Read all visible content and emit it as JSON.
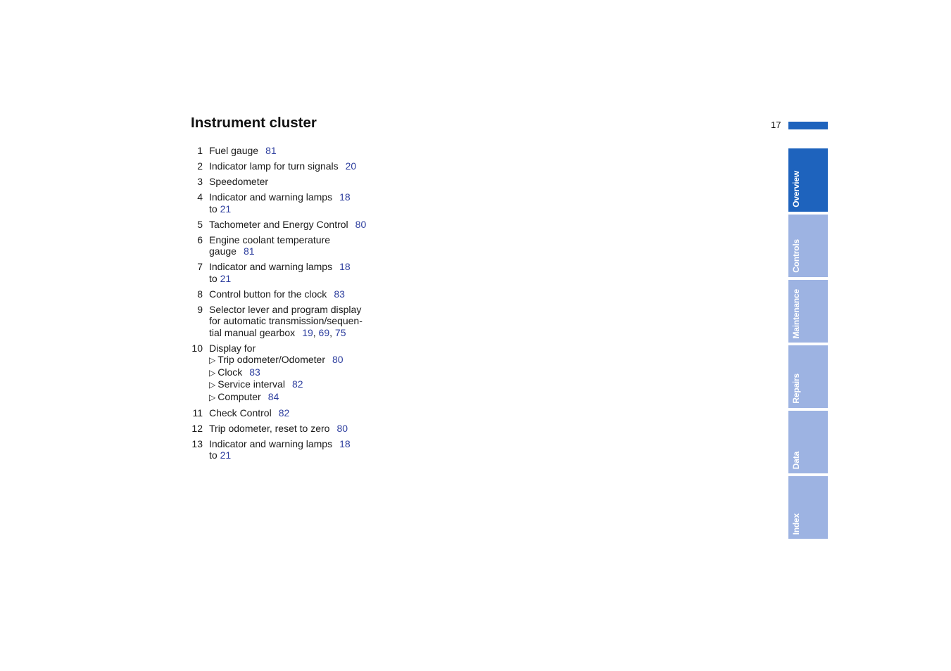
{
  "page": {
    "title": "Instrument cluster",
    "page_number": "17"
  },
  "items": [
    {
      "num": "1",
      "text": "Fuel gauge",
      "refs": [
        "81"
      ]
    },
    {
      "num": "2",
      "text": "Indicator lamp for turn signals",
      "refs": [
        "20"
      ]
    },
    {
      "num": "3",
      "text": "Speedometer",
      "refs": []
    },
    {
      "num": "4",
      "text": "Indicator and warning lamps",
      "refs": [
        "18"
      ],
      "cont_prefix": "to",
      "cont_ref": "21"
    },
    {
      "num": "5",
      "text": "Tachometer and Energy Control",
      "refs": [
        "80"
      ]
    },
    {
      "num": "6",
      "text": "Engine coolant temperature",
      "cont_text": "gauge",
      "cont_ref": "81"
    },
    {
      "num": "7",
      "text": "Indicator and warning lamps",
      "refs": [
        "18"
      ],
      "cont_prefix": "to",
      "cont_ref": "21"
    },
    {
      "num": "8",
      "text": "Control button for the clock",
      "refs": [
        "83"
      ]
    },
    {
      "num": "9",
      "lines": [
        "Selector lever and program display",
        "for automatic transmission/sequen-",
        "tial manual gearbox"
      ],
      "refs": [
        "19",
        "69",
        "75"
      ]
    },
    {
      "num": "10",
      "text": "Display for",
      "subitems": [
        {
          "bullet": "▷",
          "text": "Trip odometer/Odometer",
          "ref": "80"
        },
        {
          "bullet": "▷",
          "text": "Clock",
          "ref": "83"
        },
        {
          "bullet": "▷",
          "text": "Service interval",
          "ref": "82"
        },
        {
          "bullet": "▷",
          "text": "Computer",
          "ref": "84"
        }
      ]
    },
    {
      "num": "11",
      "text": "Check Control",
      "refs": [
        "82"
      ]
    },
    {
      "num": "12",
      "text": "Trip odometer, reset to zero",
      "refs": [
        "80"
      ]
    },
    {
      "num": "13",
      "text": "Indicator and warning lamps",
      "refs": [
        "18"
      ],
      "cont_prefix": "to",
      "cont_ref": "21"
    }
  ],
  "tabs": [
    {
      "label": "Overview",
      "active": true
    },
    {
      "label": "Controls",
      "active": false
    },
    {
      "label": "Maintenance",
      "active": false
    },
    {
      "label": "Repairs",
      "active": false
    },
    {
      "label": "Data",
      "active": false
    },
    {
      "label": "Index",
      "active": false
    }
  ],
  "colors": {
    "link": "#2d3e9e",
    "tab_active": "#1e63bd",
    "tab_inactive": "#9db3e2"
  }
}
